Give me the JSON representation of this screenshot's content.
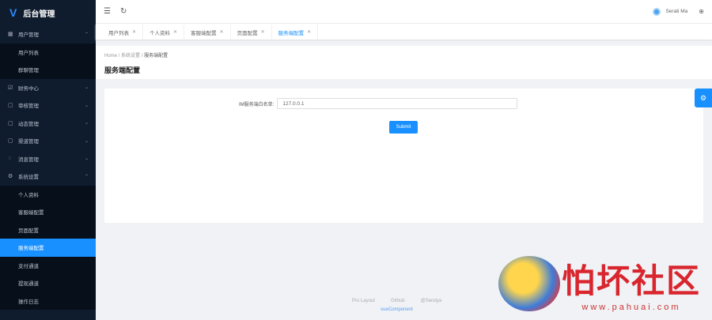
{
  "app": {
    "title": "后台管理"
  },
  "sidebar": {
    "groups": [
      {
        "label": "用户管理",
        "icon": "grid-icon",
        "expanded": true,
        "items": [
          "用户列表",
          "群聊管理"
        ]
      },
      {
        "label": "财务中心",
        "icon": "checklist-icon",
        "expanded": false
      },
      {
        "label": "审核管理",
        "icon": "square-icon",
        "expanded": false
      },
      {
        "label": "动态管理",
        "icon": "square-icon",
        "expanded": false
      },
      {
        "label": "渠道管理",
        "icon": "square-icon",
        "expanded": false
      },
      {
        "label": "消息管理",
        "icon": "message-icon",
        "expanded": false
      },
      {
        "label": "系统设置",
        "icon": "gear-icon",
        "expanded": true,
        "items": [
          "个人资料",
          "客服端配置",
          "页面配置",
          "服务端配置",
          "支付通道",
          "提现通道",
          "操作日志"
        ],
        "active": "服务端配置"
      }
    ]
  },
  "topbar": {
    "user": "Serati Ma"
  },
  "tabs": [
    "用户列表",
    "个人资料",
    "客服端配置",
    "页面配置",
    "服务端配置"
  ],
  "active_tab": "服务端配置",
  "breadcrumb": [
    "Home",
    "系统设置",
    "服务端配置"
  ],
  "page_title": "服务端配置",
  "form": {
    "label": "IM服务端白名单:",
    "value": "127.0.0.1",
    "submit": "Submit"
  },
  "footer": {
    "links": [
      "Pro Layout",
      "Github",
      "@Sendya"
    ],
    "brand": "vueComponent"
  },
  "watermark": {
    "title": "怕坏社区",
    "url": "www.pahuai.com"
  },
  "colors": {
    "accent": "#1890ff",
    "sidebar": "#0f1c2e"
  }
}
